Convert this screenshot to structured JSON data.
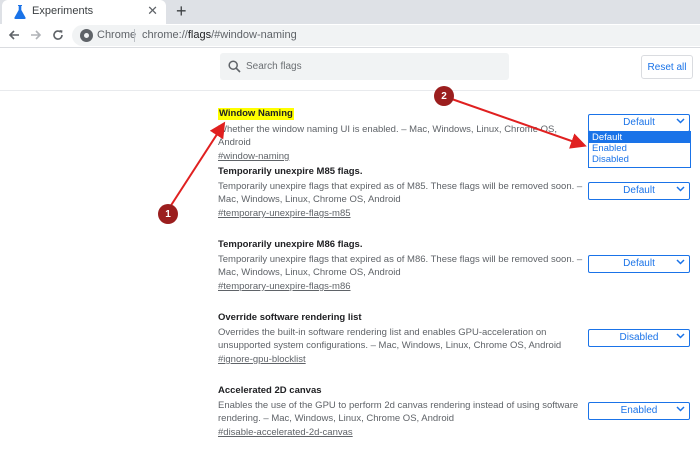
{
  "tab": {
    "title": "Experiments",
    "close": "✕",
    "new_tab": "+"
  },
  "toolbar": {
    "chrome_label": "Chrome",
    "url_prefix": "chrome://",
    "url_host": "flags",
    "url_path": "/#window-naming"
  },
  "header": {
    "search_placeholder": "Search flags",
    "reset_label": "Reset all"
  },
  "flags": [
    {
      "title": "Window Naming",
      "desc": "Whether the window naming UI is enabled. – Mac, Windows, Linux, Chrome OS, Android",
      "link": "#window-naming",
      "value": "Default"
    },
    {
      "title": "Temporarily unexpire M85 flags.",
      "desc": "Temporarily unexpire flags that expired as of M85. These flags will be removed soon. – Mac, Windows, Linux, Chrome OS, Android",
      "link": "#temporary-unexpire-flags-m85",
      "value": "Default"
    },
    {
      "title": "Temporarily unexpire M86 flags.",
      "desc": "Temporarily unexpire flags that expired as of M86. These flags will be removed soon. – Mac, Windows, Linux, Chrome OS, Android",
      "link": "#temporary-unexpire-flags-m86",
      "value": "Default"
    },
    {
      "title": "Override software rendering list",
      "desc": "Overrides the built-in software rendering list and enables GPU-acceleration on unsupported system configurations. – Mac, Windows, Linux, Chrome OS, Android",
      "link": "#ignore-gpu-blocklist",
      "value": "Disabled"
    },
    {
      "title": "Accelerated 2D canvas",
      "desc": "Enables the use of the GPU to perform 2d canvas rendering instead of using software rendering. – Mac, Windows, Linux, Chrome OS, Android",
      "link": "#disable-accelerated-2d-canvas",
      "value": "Enabled"
    }
  ],
  "dropdown_options": [
    "Default",
    "Enabled",
    "Disabled"
  ],
  "annotations": {
    "badge_1": "1",
    "badge_2": "2"
  },
  "colors": {
    "accent": "#1a73e8",
    "highlight": "#ffff00",
    "arrow": "#e02020",
    "badge": "#9b1e1e"
  }
}
